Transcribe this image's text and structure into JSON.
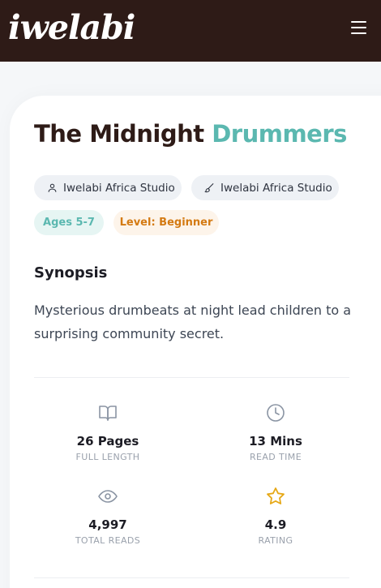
{
  "header": {
    "logo_text": "iwelabi",
    "menu_icon": "hamburger-menu-icon"
  },
  "book": {
    "title_main": "The Midnight",
    "title_accent": "Drummers",
    "author": "Iwelabi Africa Studio",
    "illustrator": "Iwelabi Africa Studio",
    "age": "Ages 5-7",
    "level": "Level: Beginner"
  },
  "synopsis": {
    "heading": "Synopsis",
    "text": "Mysterious drumbeats at night lead children to a surprising community secret."
  },
  "stats": [
    {
      "icon": "open-book-icon",
      "value": "26 Pages",
      "label": "FULL LENGTH"
    },
    {
      "icon": "clock-icon",
      "value": "13 Mins",
      "label": "READ TIME"
    },
    {
      "icon": "eye-icon",
      "value": "4,997",
      "label": "TOTAL READS"
    },
    {
      "icon": "star-icon",
      "value": "4.9",
      "label": "RATING"
    }
  ],
  "colors": {
    "header_bg": "#2e1b17",
    "accent_teal": "#5bb8b0",
    "level_orange": "#d47a12",
    "star_yellow": "#e6a817"
  }
}
